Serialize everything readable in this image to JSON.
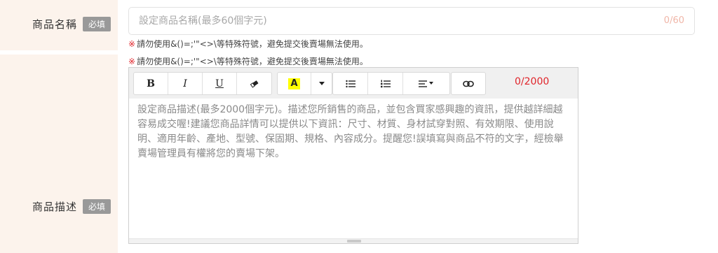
{
  "product_name": {
    "label": "商品名稱",
    "required_badge": "必填",
    "placeholder": "設定商品名稱(最多60個字元)",
    "counter": "0/60",
    "warning_mark": "※",
    "warning": "請勿使用&()=;'\"<>\\等特殊符號，避免提交後賣場無法使用。"
  },
  "product_description": {
    "label": "商品描述",
    "required_badge": "必填",
    "warning_mark": "※",
    "warning": "請勿使用&()=;'\"<>\\等特殊符號，避免提交後賣場無法使用。",
    "char_count": "0/2000",
    "placeholder": "設定商品描述(最多2000個字元)。描述您所銷售的商品，並包含買家感興趣的資訊，提供越詳細越容易成交喔!建議您商品詳情可以提供以下資訊：尺寸、材質、身材試穿對照、有效期限、使用說明、適用年齡、產地、型號、保固期、規格、內容成分。提醒您!誤填寫與商品不符的文字，經檢舉賣場管理員有權將您的賣場下架。",
    "toolbar": {
      "bold": "B",
      "italic": "I",
      "underline": "U",
      "highlight": "A",
      "icons": [
        "eraser-icon",
        "caret-down-icon",
        "bullet-list-icon",
        "numbered-list-icon",
        "align-icon",
        "link-icon"
      ]
    }
  },
  "colors": {
    "label_bg": "#fcf3ec",
    "badge_bg": "#999999",
    "warning_red": "#e0242a",
    "counter_peach": "#f0b6a8"
  }
}
